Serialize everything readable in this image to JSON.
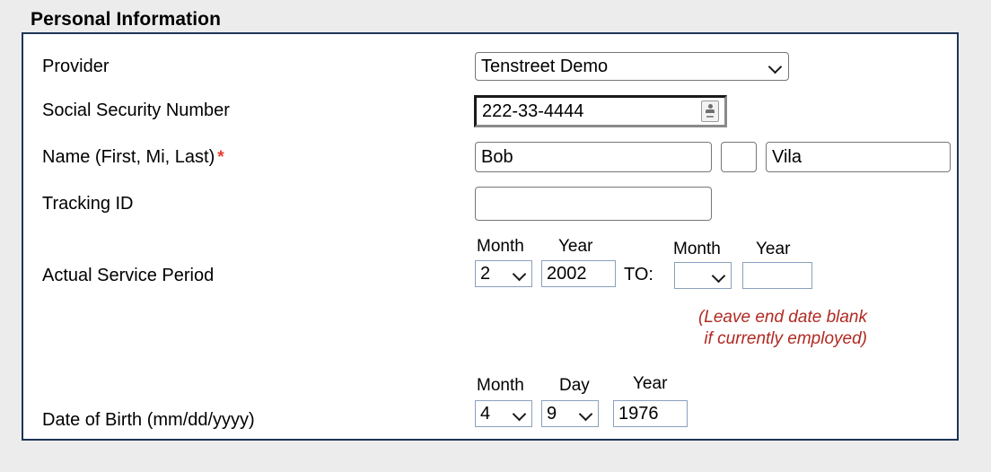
{
  "section": {
    "title": "Personal Information",
    "border_color": "#1d3557",
    "page_background": "#ececec"
  },
  "fields": {
    "provider": {
      "label": "Provider",
      "value": "Tenstreet Demo",
      "icon": "chevron-down-icon"
    },
    "ssn": {
      "label": "Social Security Number",
      "value": "222-33-4444",
      "icon": "contact-card-icon"
    },
    "name": {
      "label": "Name (First, Mi, Last)",
      "required_marker": "*",
      "required_color": "#e8392b",
      "first": "Bob",
      "middle": "",
      "last": "Vila"
    },
    "tracking_id": {
      "label": "Tracking ID",
      "value": ""
    },
    "service_period": {
      "label": "Actual Service Period",
      "separator": "TO:",
      "start": {
        "month_label": "Month",
        "month_value": "2",
        "year_label": "Year",
        "year_value": "2002"
      },
      "end": {
        "month_label": "Month",
        "month_value": "",
        "year_label": "Year",
        "year_value": ""
      },
      "note_line1": "(Leave end date blank",
      "note_line2": "if currently employed)",
      "note_color": "#b02a22"
    },
    "date_of_birth": {
      "label": "Date of Birth (mm/dd/yyyy)",
      "month_label": "Month",
      "month_value": "4",
      "day_label": "Day",
      "day_value": "9",
      "year_label": "Year",
      "year_value": "1976"
    }
  }
}
